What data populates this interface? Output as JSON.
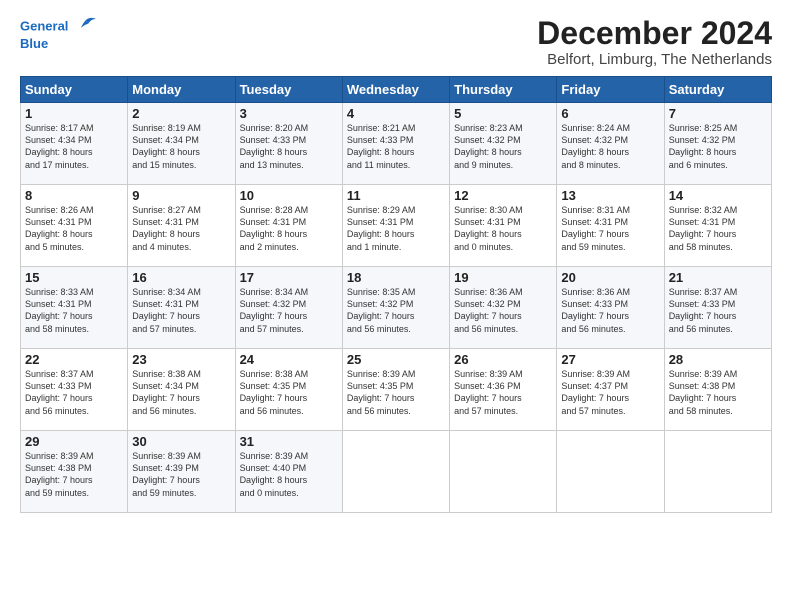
{
  "logo": {
    "line1": "General",
    "line2": "Blue"
  },
  "title": "December 2024",
  "subtitle": "Belfort, Limburg, The Netherlands",
  "header_row": [
    "Sunday",
    "Monday",
    "Tuesday",
    "Wednesday",
    "Thursday",
    "Friday",
    "Saturday"
  ],
  "weeks": [
    [
      {
        "day": "1",
        "lines": [
          "Sunrise: 8:17 AM",
          "Sunset: 4:34 PM",
          "Daylight: 8 hours",
          "and 17 minutes."
        ]
      },
      {
        "day": "2",
        "lines": [
          "Sunrise: 8:19 AM",
          "Sunset: 4:34 PM",
          "Daylight: 8 hours",
          "and 15 minutes."
        ]
      },
      {
        "day": "3",
        "lines": [
          "Sunrise: 8:20 AM",
          "Sunset: 4:33 PM",
          "Daylight: 8 hours",
          "and 13 minutes."
        ]
      },
      {
        "day": "4",
        "lines": [
          "Sunrise: 8:21 AM",
          "Sunset: 4:33 PM",
          "Daylight: 8 hours",
          "and 11 minutes."
        ]
      },
      {
        "day": "5",
        "lines": [
          "Sunrise: 8:23 AM",
          "Sunset: 4:32 PM",
          "Daylight: 8 hours",
          "and 9 minutes."
        ]
      },
      {
        "day": "6",
        "lines": [
          "Sunrise: 8:24 AM",
          "Sunset: 4:32 PM",
          "Daylight: 8 hours",
          "and 8 minutes."
        ]
      },
      {
        "day": "7",
        "lines": [
          "Sunrise: 8:25 AM",
          "Sunset: 4:32 PM",
          "Daylight: 8 hours",
          "and 6 minutes."
        ]
      }
    ],
    [
      {
        "day": "8",
        "lines": [
          "Sunrise: 8:26 AM",
          "Sunset: 4:31 PM",
          "Daylight: 8 hours",
          "and 5 minutes."
        ]
      },
      {
        "day": "9",
        "lines": [
          "Sunrise: 8:27 AM",
          "Sunset: 4:31 PM",
          "Daylight: 8 hours",
          "and 4 minutes."
        ]
      },
      {
        "day": "10",
        "lines": [
          "Sunrise: 8:28 AM",
          "Sunset: 4:31 PM",
          "Daylight: 8 hours",
          "and 2 minutes."
        ]
      },
      {
        "day": "11",
        "lines": [
          "Sunrise: 8:29 AM",
          "Sunset: 4:31 PM",
          "Daylight: 8 hours",
          "and 1 minute."
        ]
      },
      {
        "day": "12",
        "lines": [
          "Sunrise: 8:30 AM",
          "Sunset: 4:31 PM",
          "Daylight: 8 hours",
          "and 0 minutes."
        ]
      },
      {
        "day": "13",
        "lines": [
          "Sunrise: 8:31 AM",
          "Sunset: 4:31 PM",
          "Daylight: 7 hours",
          "and 59 minutes."
        ]
      },
      {
        "day": "14",
        "lines": [
          "Sunrise: 8:32 AM",
          "Sunset: 4:31 PM",
          "Daylight: 7 hours",
          "and 58 minutes."
        ]
      }
    ],
    [
      {
        "day": "15",
        "lines": [
          "Sunrise: 8:33 AM",
          "Sunset: 4:31 PM",
          "Daylight: 7 hours",
          "and 58 minutes."
        ]
      },
      {
        "day": "16",
        "lines": [
          "Sunrise: 8:34 AM",
          "Sunset: 4:31 PM",
          "Daylight: 7 hours",
          "and 57 minutes."
        ]
      },
      {
        "day": "17",
        "lines": [
          "Sunrise: 8:34 AM",
          "Sunset: 4:32 PM",
          "Daylight: 7 hours",
          "and 57 minutes."
        ]
      },
      {
        "day": "18",
        "lines": [
          "Sunrise: 8:35 AM",
          "Sunset: 4:32 PM",
          "Daylight: 7 hours",
          "and 56 minutes."
        ]
      },
      {
        "day": "19",
        "lines": [
          "Sunrise: 8:36 AM",
          "Sunset: 4:32 PM",
          "Daylight: 7 hours",
          "and 56 minutes."
        ]
      },
      {
        "day": "20",
        "lines": [
          "Sunrise: 8:36 AM",
          "Sunset: 4:33 PM",
          "Daylight: 7 hours",
          "and 56 minutes."
        ]
      },
      {
        "day": "21",
        "lines": [
          "Sunrise: 8:37 AM",
          "Sunset: 4:33 PM",
          "Daylight: 7 hours",
          "and 56 minutes."
        ]
      }
    ],
    [
      {
        "day": "22",
        "lines": [
          "Sunrise: 8:37 AM",
          "Sunset: 4:33 PM",
          "Daylight: 7 hours",
          "and 56 minutes."
        ]
      },
      {
        "day": "23",
        "lines": [
          "Sunrise: 8:38 AM",
          "Sunset: 4:34 PM",
          "Daylight: 7 hours",
          "and 56 minutes."
        ]
      },
      {
        "day": "24",
        "lines": [
          "Sunrise: 8:38 AM",
          "Sunset: 4:35 PM",
          "Daylight: 7 hours",
          "and 56 minutes."
        ]
      },
      {
        "day": "25",
        "lines": [
          "Sunrise: 8:39 AM",
          "Sunset: 4:35 PM",
          "Daylight: 7 hours",
          "and 56 minutes."
        ]
      },
      {
        "day": "26",
        "lines": [
          "Sunrise: 8:39 AM",
          "Sunset: 4:36 PM",
          "Daylight: 7 hours",
          "and 57 minutes."
        ]
      },
      {
        "day": "27",
        "lines": [
          "Sunrise: 8:39 AM",
          "Sunset: 4:37 PM",
          "Daylight: 7 hours",
          "and 57 minutes."
        ]
      },
      {
        "day": "28",
        "lines": [
          "Sunrise: 8:39 AM",
          "Sunset: 4:38 PM",
          "Daylight: 7 hours",
          "and 58 minutes."
        ]
      }
    ],
    [
      {
        "day": "29",
        "lines": [
          "Sunrise: 8:39 AM",
          "Sunset: 4:38 PM",
          "Daylight: 7 hours",
          "and 59 minutes."
        ]
      },
      {
        "day": "30",
        "lines": [
          "Sunrise: 8:39 AM",
          "Sunset: 4:39 PM",
          "Daylight: 7 hours",
          "and 59 minutes."
        ]
      },
      {
        "day": "31",
        "lines": [
          "Sunrise: 8:39 AM",
          "Sunset: 4:40 PM",
          "Daylight: 8 hours",
          "and 0 minutes."
        ]
      },
      null,
      null,
      null,
      null
    ]
  ]
}
